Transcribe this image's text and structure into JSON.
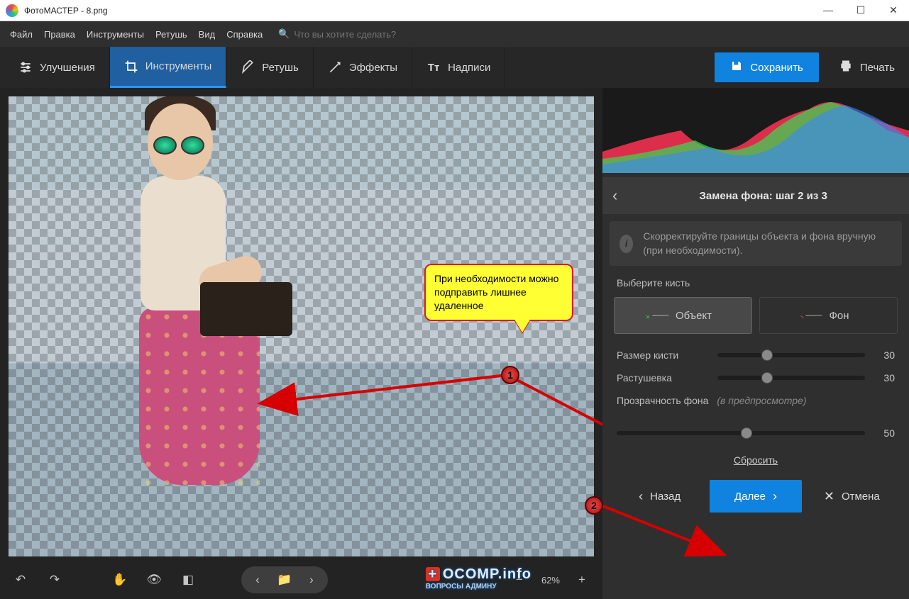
{
  "window": {
    "title": "ФотоМАСТЕР - 8.png"
  },
  "menu": {
    "file": "Файл",
    "edit": "Правка",
    "tools": "Инструменты",
    "retouch": "Ретушь",
    "view": "Вид",
    "help": "Справка",
    "search_placeholder": "Что вы хотите сделать?"
  },
  "tabs": {
    "enhance": "Улучшения",
    "tools": "Инструменты",
    "retouch": "Ретушь",
    "effects": "Эффекты",
    "text": "Надписи"
  },
  "actions": {
    "save": "Сохранить",
    "print": "Печать"
  },
  "panel": {
    "title": "Замена фона: шаг 2 из 3",
    "info": "Скорректируйте границы объекта и фона вручную (при необходимости).",
    "choose_brush": "Выберите кисть",
    "brush_object": "Объект",
    "brush_background": "Фон",
    "brush_size_label": "Размер кисти",
    "brush_size_value": "30",
    "feather_label": "Растушевка",
    "feather_value": "30",
    "opacity_label": "Прозрачность фона",
    "opacity_hint": "(в предпросмотре)",
    "opacity_value": "50",
    "reset": "Сбросить",
    "back": "Назад",
    "next": "Далее",
    "cancel": "Отмена"
  },
  "callout": {
    "text": "При необходимости можно подправить лишнее удаленное",
    "marker1": "1",
    "marker2": "2"
  },
  "watermark": {
    "main": "OCOMP.info",
    "sub": "ВОПРОСЫ АДМИНУ"
  },
  "bottombar": {
    "zoom": "62%"
  }
}
